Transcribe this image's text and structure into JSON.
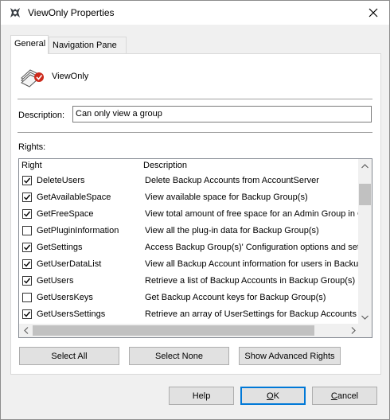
{
  "window": {
    "title": "ViewOnly Properties",
    "app_icon": "lotus-icon",
    "close_icon": "close-icon"
  },
  "tabs": [
    {
      "label": "General",
      "active": true
    },
    {
      "label": "Navigation Pane",
      "active": false
    }
  ],
  "group": {
    "name": "ViewOnly",
    "icon": "group-icon"
  },
  "description": {
    "label": "Description:",
    "value": "Can only view a group"
  },
  "rights": {
    "label": "Rights:",
    "columns": [
      "Right",
      "Description"
    ],
    "rows": [
      {
        "name": "DeleteUsers",
        "description": "Delete Backup Accounts from AccountServer",
        "checked": true
      },
      {
        "name": "GetAvailableSpace",
        "description": "View available space for Backup Group(s)",
        "checked": true
      },
      {
        "name": "GetFreeSpace",
        "description": "View total amount of free space for an Admin Group in C",
        "checked": true
      },
      {
        "name": "GetPluginInformation",
        "description": "View all the plug-in data for Backup Group(s)",
        "checked": false
      },
      {
        "name": "GetSettings",
        "description": "Access Backup Group(s)' Configuration options and sett",
        "checked": true
      },
      {
        "name": "GetUserDataList",
        "description": "View all Backup Account information for users in Backup",
        "checked": true
      },
      {
        "name": "GetUsers",
        "description": "Retrieve a list of Backup Accounts in Backup Group(s)",
        "checked": true
      },
      {
        "name": "GetUsersKeys",
        "description": "Get Backup Account keys for Backup Group(s)",
        "checked": false
      },
      {
        "name": "GetUsersSettings",
        "description": "Retrieve an array of UserSettings for Backup Accounts",
        "checked": true
      }
    ]
  },
  "buttons": {
    "select_all": "Select All",
    "select_none": "Select None",
    "advanced": "Show Advanced Rights",
    "help": "Help",
    "ok": "OK",
    "ok_mnemonic": "O",
    "ok_rest": "K",
    "cancel": "Cancel",
    "cancel_mnemonic": "C",
    "cancel_rest": "ancel"
  },
  "colors": {
    "accent": "#0078d7",
    "dialog_bg": "#f0f0f0",
    "button_bg": "#e1e1e1"
  }
}
